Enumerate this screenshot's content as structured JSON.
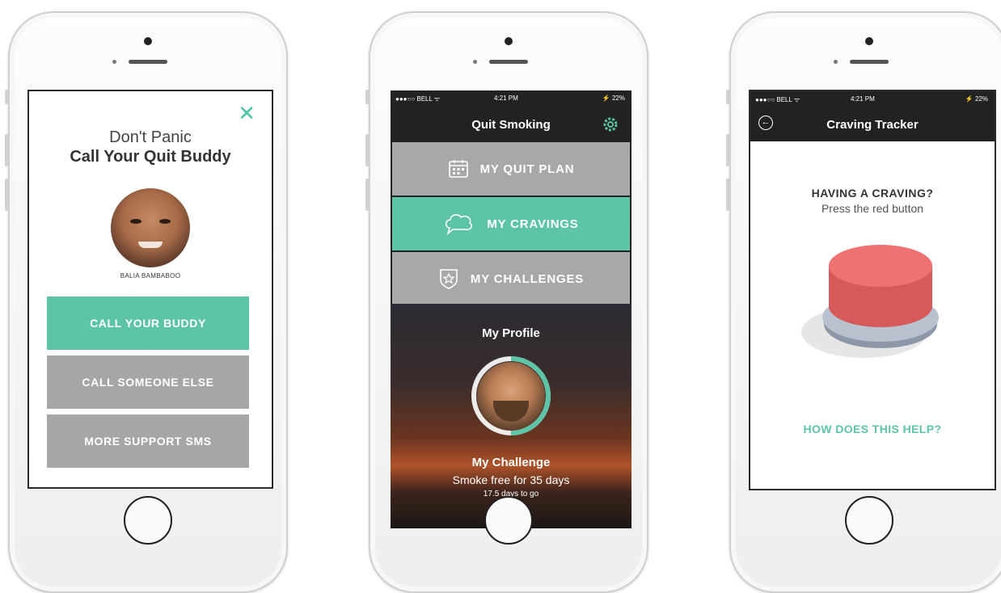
{
  "phone1": {
    "close_glyph": "✕",
    "title_line1": "Don't Panic",
    "title_line2": "Call Your Quit Buddy",
    "buddy_name": "BALIA BAMBABOO",
    "buttons": [
      {
        "label": "CALL YOUR BUDDY",
        "color": "#5ec4a8"
      },
      {
        "label": "CALL SOMEONE ELSE",
        "color": "#a6a6a6"
      },
      {
        "label": "MORE SUPPORT SMS",
        "color": "#a6a6a6"
      }
    ]
  },
  "phone2": {
    "status": {
      "carrier": "●●●○○ BELL ᯤ",
      "time": "4:21 PM",
      "battery": "⚡ 22%"
    },
    "title": "Quit Smoking",
    "menu": [
      {
        "label": "MY QUIT PLAN",
        "icon": "calendar-icon",
        "color": "#a8a8a8"
      },
      {
        "label": "MY CRAVINGS",
        "icon": "speech-bubble-icon",
        "color": "#5ec4a8"
      },
      {
        "label": "MY CHALLENGES",
        "icon": "star-badge-icon",
        "color": "#a8a8a8"
      }
    ],
    "profile_title": "My Profile",
    "progress_fraction": 0.5,
    "challenge_title": "My Challenge",
    "challenge_desc": "Smoke free for 35 days",
    "challenge_remaining": "17.5 days to go"
  },
  "phone3": {
    "status": {
      "carrier": "●●●○○ BELL ᯤ",
      "time": "4:21 PM",
      "battery": "⚡ 22%"
    },
    "title": "Craving Tracker",
    "question": "HAVING A CRAVING?",
    "hint": "Press the red button",
    "help_link": "HOW DOES THIS HELP?"
  },
  "colors": {
    "accent": "#5ec4a8",
    "grey": "#a6a6a6",
    "dark": "#222222",
    "red_button": "#ef7272"
  }
}
